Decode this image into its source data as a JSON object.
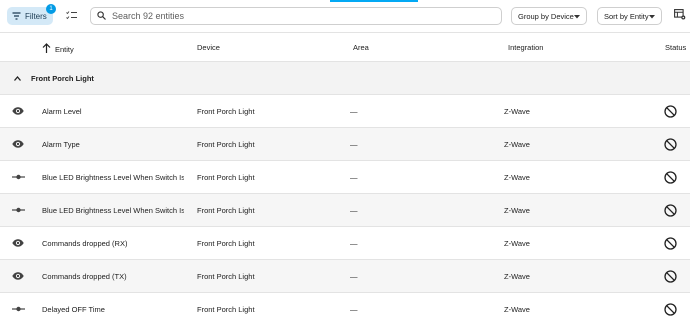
{
  "toolbar": {
    "filters_label": "Filters",
    "filters_badge": "1",
    "search_placeholder": "Search 92 entities",
    "group_by_label": "Group by Device",
    "sort_by_label": "Sort by Entity"
  },
  "colors": {
    "accent": "#03a9f4",
    "filters_bg": "#d4e9f7",
    "badge": "#039be5",
    "alt_row": "#f6f6f6",
    "group_bg": "#f3f3f3"
  },
  "columns": {
    "entity": "Entity",
    "device": "Device",
    "area": "Area",
    "integration": "Integration",
    "status": "Status"
  },
  "group": {
    "title": "Front Porch Light"
  },
  "rows": [
    {
      "icon": "eye-icon",
      "entity": "Alarm Level",
      "device": "Front Porch Light",
      "area": "—",
      "integration": "Z-Wave",
      "status_icon": "disabled-icon"
    },
    {
      "icon": "eye-icon",
      "entity": "Alarm Type",
      "device": "Front Porch Light",
      "area": "—",
      "integration": "Z-Wave",
      "status_icon": "disabled-icon"
    },
    {
      "icon": "slider-icon",
      "entity": "Blue LED Brightness Level When Switch Is ...",
      "device": "Front Porch Light",
      "area": "—",
      "integration": "Z-Wave",
      "status_icon": "disabled-icon"
    },
    {
      "icon": "slider-icon",
      "entity": "Blue LED Brightness Level When Switch Is ...",
      "device": "Front Porch Light",
      "area": "—",
      "integration": "Z-Wave",
      "status_icon": "disabled-icon"
    },
    {
      "icon": "eye-icon",
      "entity": "Commands dropped (RX)",
      "device": "Front Porch Light",
      "area": "—",
      "integration": "Z-Wave",
      "status_icon": "disabled-icon"
    },
    {
      "icon": "eye-icon",
      "entity": "Commands dropped (TX)",
      "device": "Front Porch Light",
      "area": "—",
      "integration": "Z-Wave",
      "status_icon": "disabled-icon"
    },
    {
      "icon": "slider-icon",
      "entity": "Delayed OFF Time",
      "device": "Front Porch Light",
      "area": "—",
      "integration": "Z-Wave",
      "status_icon": "disabled-icon"
    }
  ]
}
